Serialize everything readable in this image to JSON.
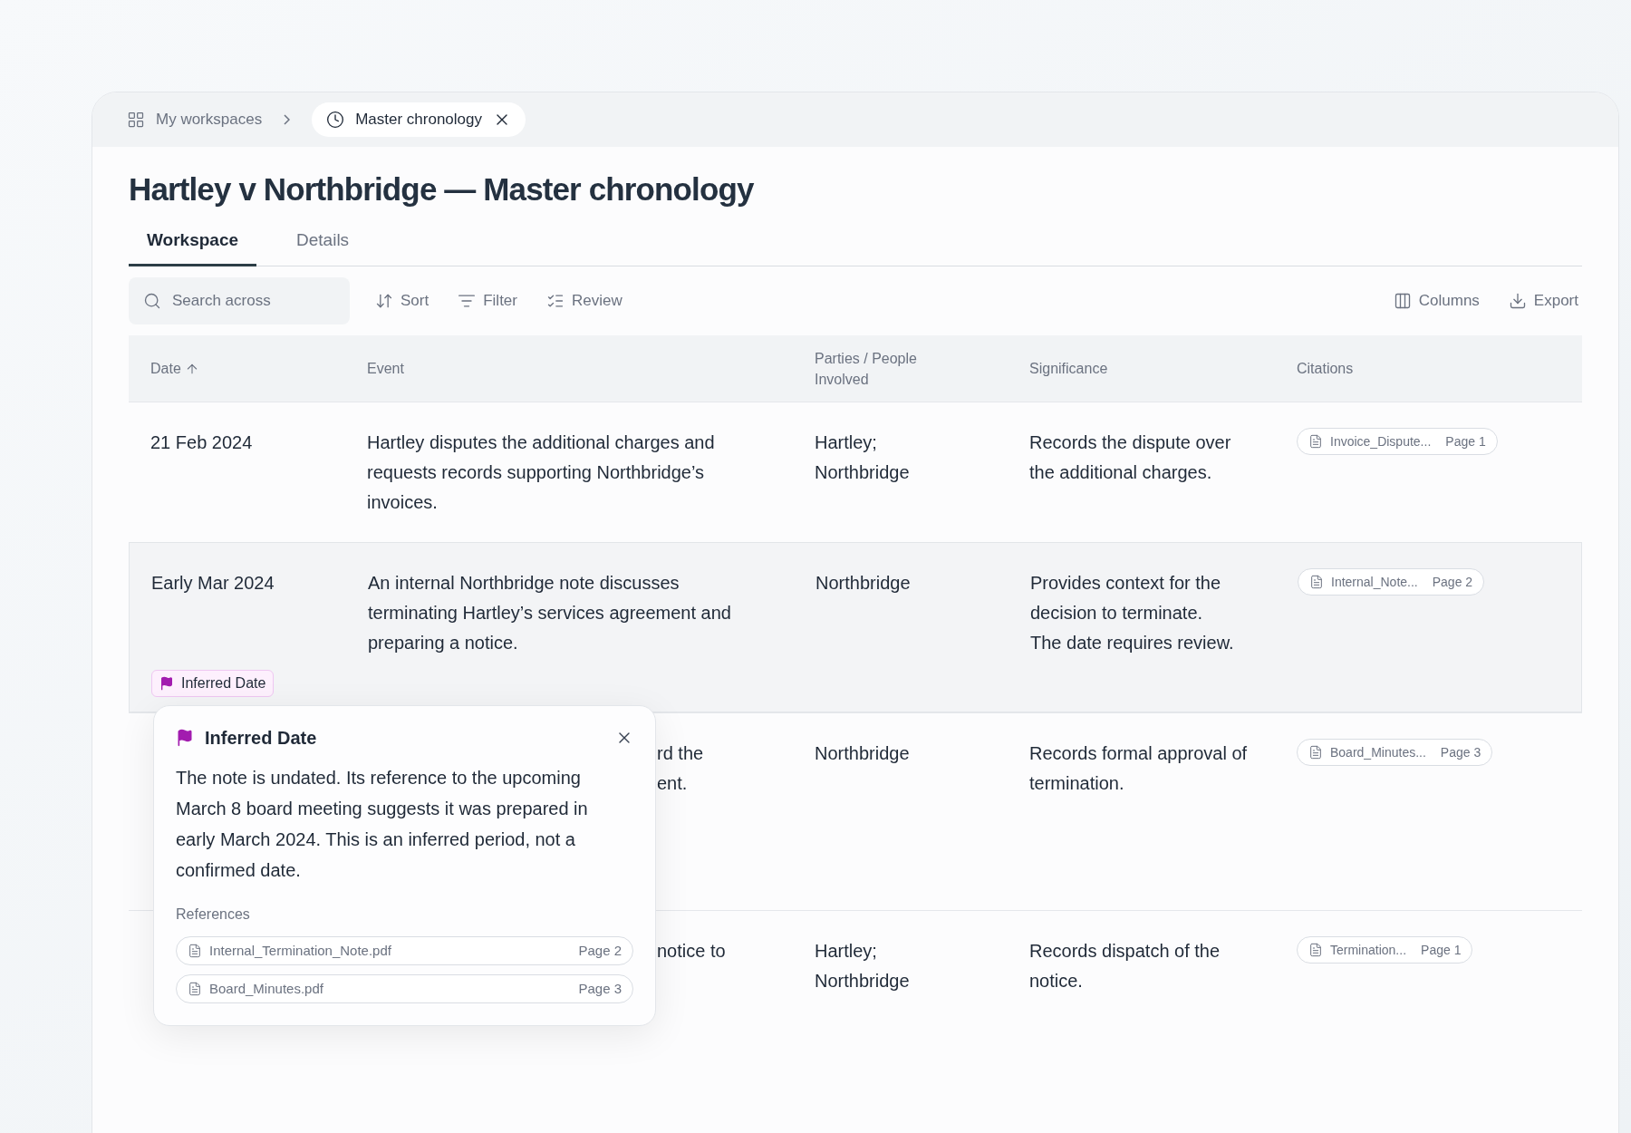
{
  "breadcrumb": {
    "root": "My workspaces",
    "current_tab": "Master chronology"
  },
  "title": "Hartley v Northbridge — Master chronology",
  "tabs": [
    {
      "label": "Workspace",
      "selected": true
    },
    {
      "label": "Details",
      "selected": false
    }
  ],
  "toolbar": {
    "search": {
      "placeholder": "Search across"
    },
    "left_actions": [
      {
        "kind": "sort",
        "label": "Sort"
      },
      {
        "kind": "filter",
        "label": "Filter"
      },
      {
        "kind": "review",
        "label": "Review"
      }
    ],
    "right_actions": [
      {
        "kind": "columns",
        "label": "Columns"
      },
      {
        "kind": "export",
        "label": "Export"
      }
    ]
  },
  "table": {
    "columns": [
      {
        "label": "Date",
        "sorted": true
      },
      {
        "label": "Event",
        "sorted": false
      },
      {
        "label": "Parties / People Involved",
        "sorted": false
      },
      {
        "label": "Significance",
        "sorted": false
      },
      {
        "label": "Citations",
        "sorted": false
      }
    ],
    "rows": [
      {
        "kind": "full",
        "selected": false,
        "date": "21 Feb 2024",
        "event": "Hartley disputes the additional charges and requests records supporting Northbridge’s invoices.",
        "parties": [
          "Hartley;",
          "Northbridge"
        ],
        "significance": [
          "Records the dispute over the additional charges."
        ],
        "citation": {
          "file": "Invoice_Dispute...",
          "page": "Page 1"
        }
      },
      {
        "kind": "full",
        "selected": true,
        "date": "Early Mar 2024",
        "badge": "Inferred Date",
        "event": "An internal Northbridge note discusses terminating Hartley’s services agreement and preparing a notice.",
        "parties": [
          "Northbridge"
        ],
        "significance": [
          "Provides context for the decision to terminate.",
          "The date requires review."
        ],
        "citation": {
          "file": "Internal_Note...",
          "page": "Page 2"
        }
      },
      {
        "kind": "covered",
        "selected": false,
        "event_lines": [
          "rd the",
          "ent."
        ],
        "parties": [
          "Northbridge"
        ],
        "significance": [
          "Records formal approval of termination."
        ],
        "citation": {
          "file": "Board_Minutes...",
          "page": "Page 3"
        }
      },
      {
        "kind": "covered",
        "selected": false,
        "event_lines": [
          "notice to"
        ],
        "parties": [
          "Hartley;",
          "Northbridge"
        ],
        "significance": [
          "Records dispatch of the notice."
        ],
        "citation": {
          "file": "Termination...",
          "page": "Page 1"
        }
      }
    ]
  },
  "popover": {
    "title": "Inferred Date",
    "body": "The note is undated. Its reference to the upcoming March 8 board meeting suggests it was prepared in early March 2024. This is an inferred period, not a confirmed date.",
    "references_label": "References",
    "references": [
      {
        "file": "Internal_Termination_Note.pdf",
        "page": "Page 2"
      },
      {
        "file": "Board_Minutes.pdf",
        "page": "Page 3"
      }
    ]
  }
}
